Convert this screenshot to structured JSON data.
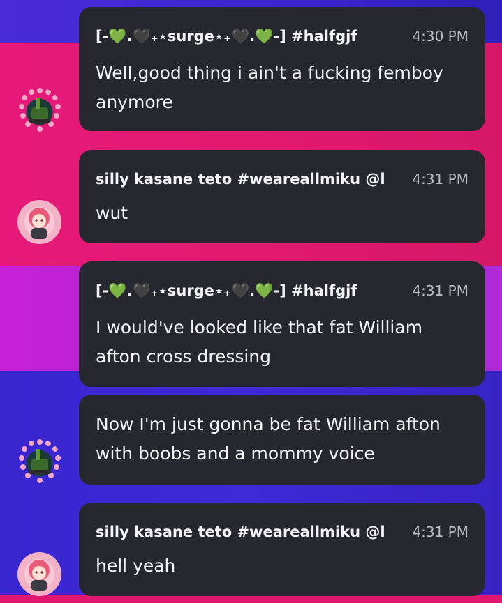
{
  "messages": [
    {
      "author": "[-💚.🖤₊⋆surge⋆₊🖤.💚-] #halfgjf",
      "time": "4:30 PM",
      "text": "Well,good thing i ain't a fucking femboy anymore",
      "avatar": "surge-avatar"
    },
    {
      "author": "silly kasane teto #weareallmiku @l",
      "time": "4:31 PM",
      "text": "wut",
      "avatar": "teto-avatar"
    },
    {
      "author": "[-💚.🖤₊⋆surge⋆₊🖤.💚-] #halfgjf",
      "time": "4:31 PM",
      "text": "I would've looked like that fat William afton cross dressing",
      "avatar": "surge-avatar"
    },
    {
      "author": "",
      "time": "",
      "text": "Now I'm just gonna be fat William afton with boobs and a mommy voice",
      "avatar": "surge-avatar"
    },
    {
      "author": "silly kasane teto #weareallmiku @l",
      "time": "4:31 PM",
      "text": "hell yeah",
      "avatar": "teto-avatar"
    }
  ],
  "colors": {
    "bubble": "#27272f",
    "text": "#f3f3f5",
    "timestamp": "#b9b9c2",
    "heart_green": "#6fd93a",
    "band_blue": "#3b24c9",
    "band_pink": "#e01a6f",
    "band_purple": "#b424d4"
  }
}
